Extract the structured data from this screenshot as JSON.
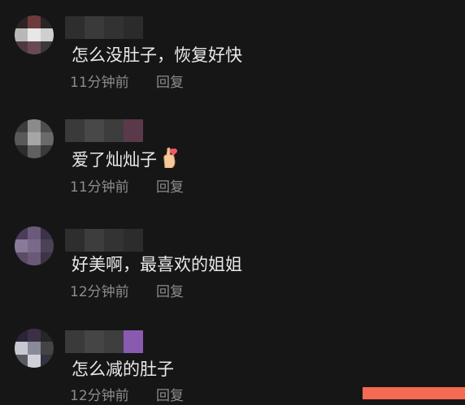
{
  "comments": [
    {
      "text": "怎么没肚子，恢复好快",
      "time": "11分钟前",
      "reply": "回复",
      "avatar_colors": [
        "#2a2424",
        "#6e3a3e",
        "#2a2424",
        "#b8b8b8",
        "#e7e7e7",
        "#cfcfcf",
        "#4d3a40",
        "#6a4a52",
        "#3a3a3a"
      ],
      "name_colors": [
        "#2e2e2e",
        "#3a3a3a",
        "#323232",
        "#2b2b2b"
      ]
    },
    {
      "text": "爱了灿灿子",
      "emoji": "finger-heart-icon",
      "time": "11分钟前",
      "reply": "回复",
      "avatar_colors": [
        "#3c3c3c",
        "#8b8b8b",
        "#4e4e4e",
        "#595959",
        "#a6a6a6",
        "#6a6a6a",
        "#2c2c2c",
        "#606060",
        "#3a3a3a"
      ],
      "name_colors": [
        "#3a3a3a",
        "#484848",
        "#3d3d3d",
        "#5a3a4a"
      ]
    },
    {
      "text": "好美啊，最喜欢的姐姐",
      "time": "12分钟前",
      "reply": "回复",
      "avatar_colors": [
        "#4a3c5a",
        "#6b5a7a",
        "#3d3248",
        "#8a7a9a",
        "#7a6a8a",
        "#4c4258",
        "#5a4c66",
        "#6a5a78",
        "#3e3446"
      ],
      "name_colors": [
        "#2e2e2e",
        "#3d3d3d",
        "#333333",
        "#2c2c2c"
      ]
    },
    {
      "text": "怎么减的肚子",
      "time": "12分钟前",
      "reply": "回复",
      "avatar_colors": [
        "#2a2438",
        "#3c3048",
        "#262626",
        "#c8c8d0",
        "#8a8a9a",
        "#444444",
        "#5a5a66",
        "#d0d0d8",
        "#333340"
      ],
      "name_colors": [
        "#3a3a3a",
        "#454545",
        "#3e3e3e",
        "#8a5ab0"
      ]
    }
  ],
  "colors": {
    "background": "#161616",
    "comment_text": "#e9e9e9",
    "meta_text": "#8c8c8c",
    "accent": "#f46a52"
  }
}
